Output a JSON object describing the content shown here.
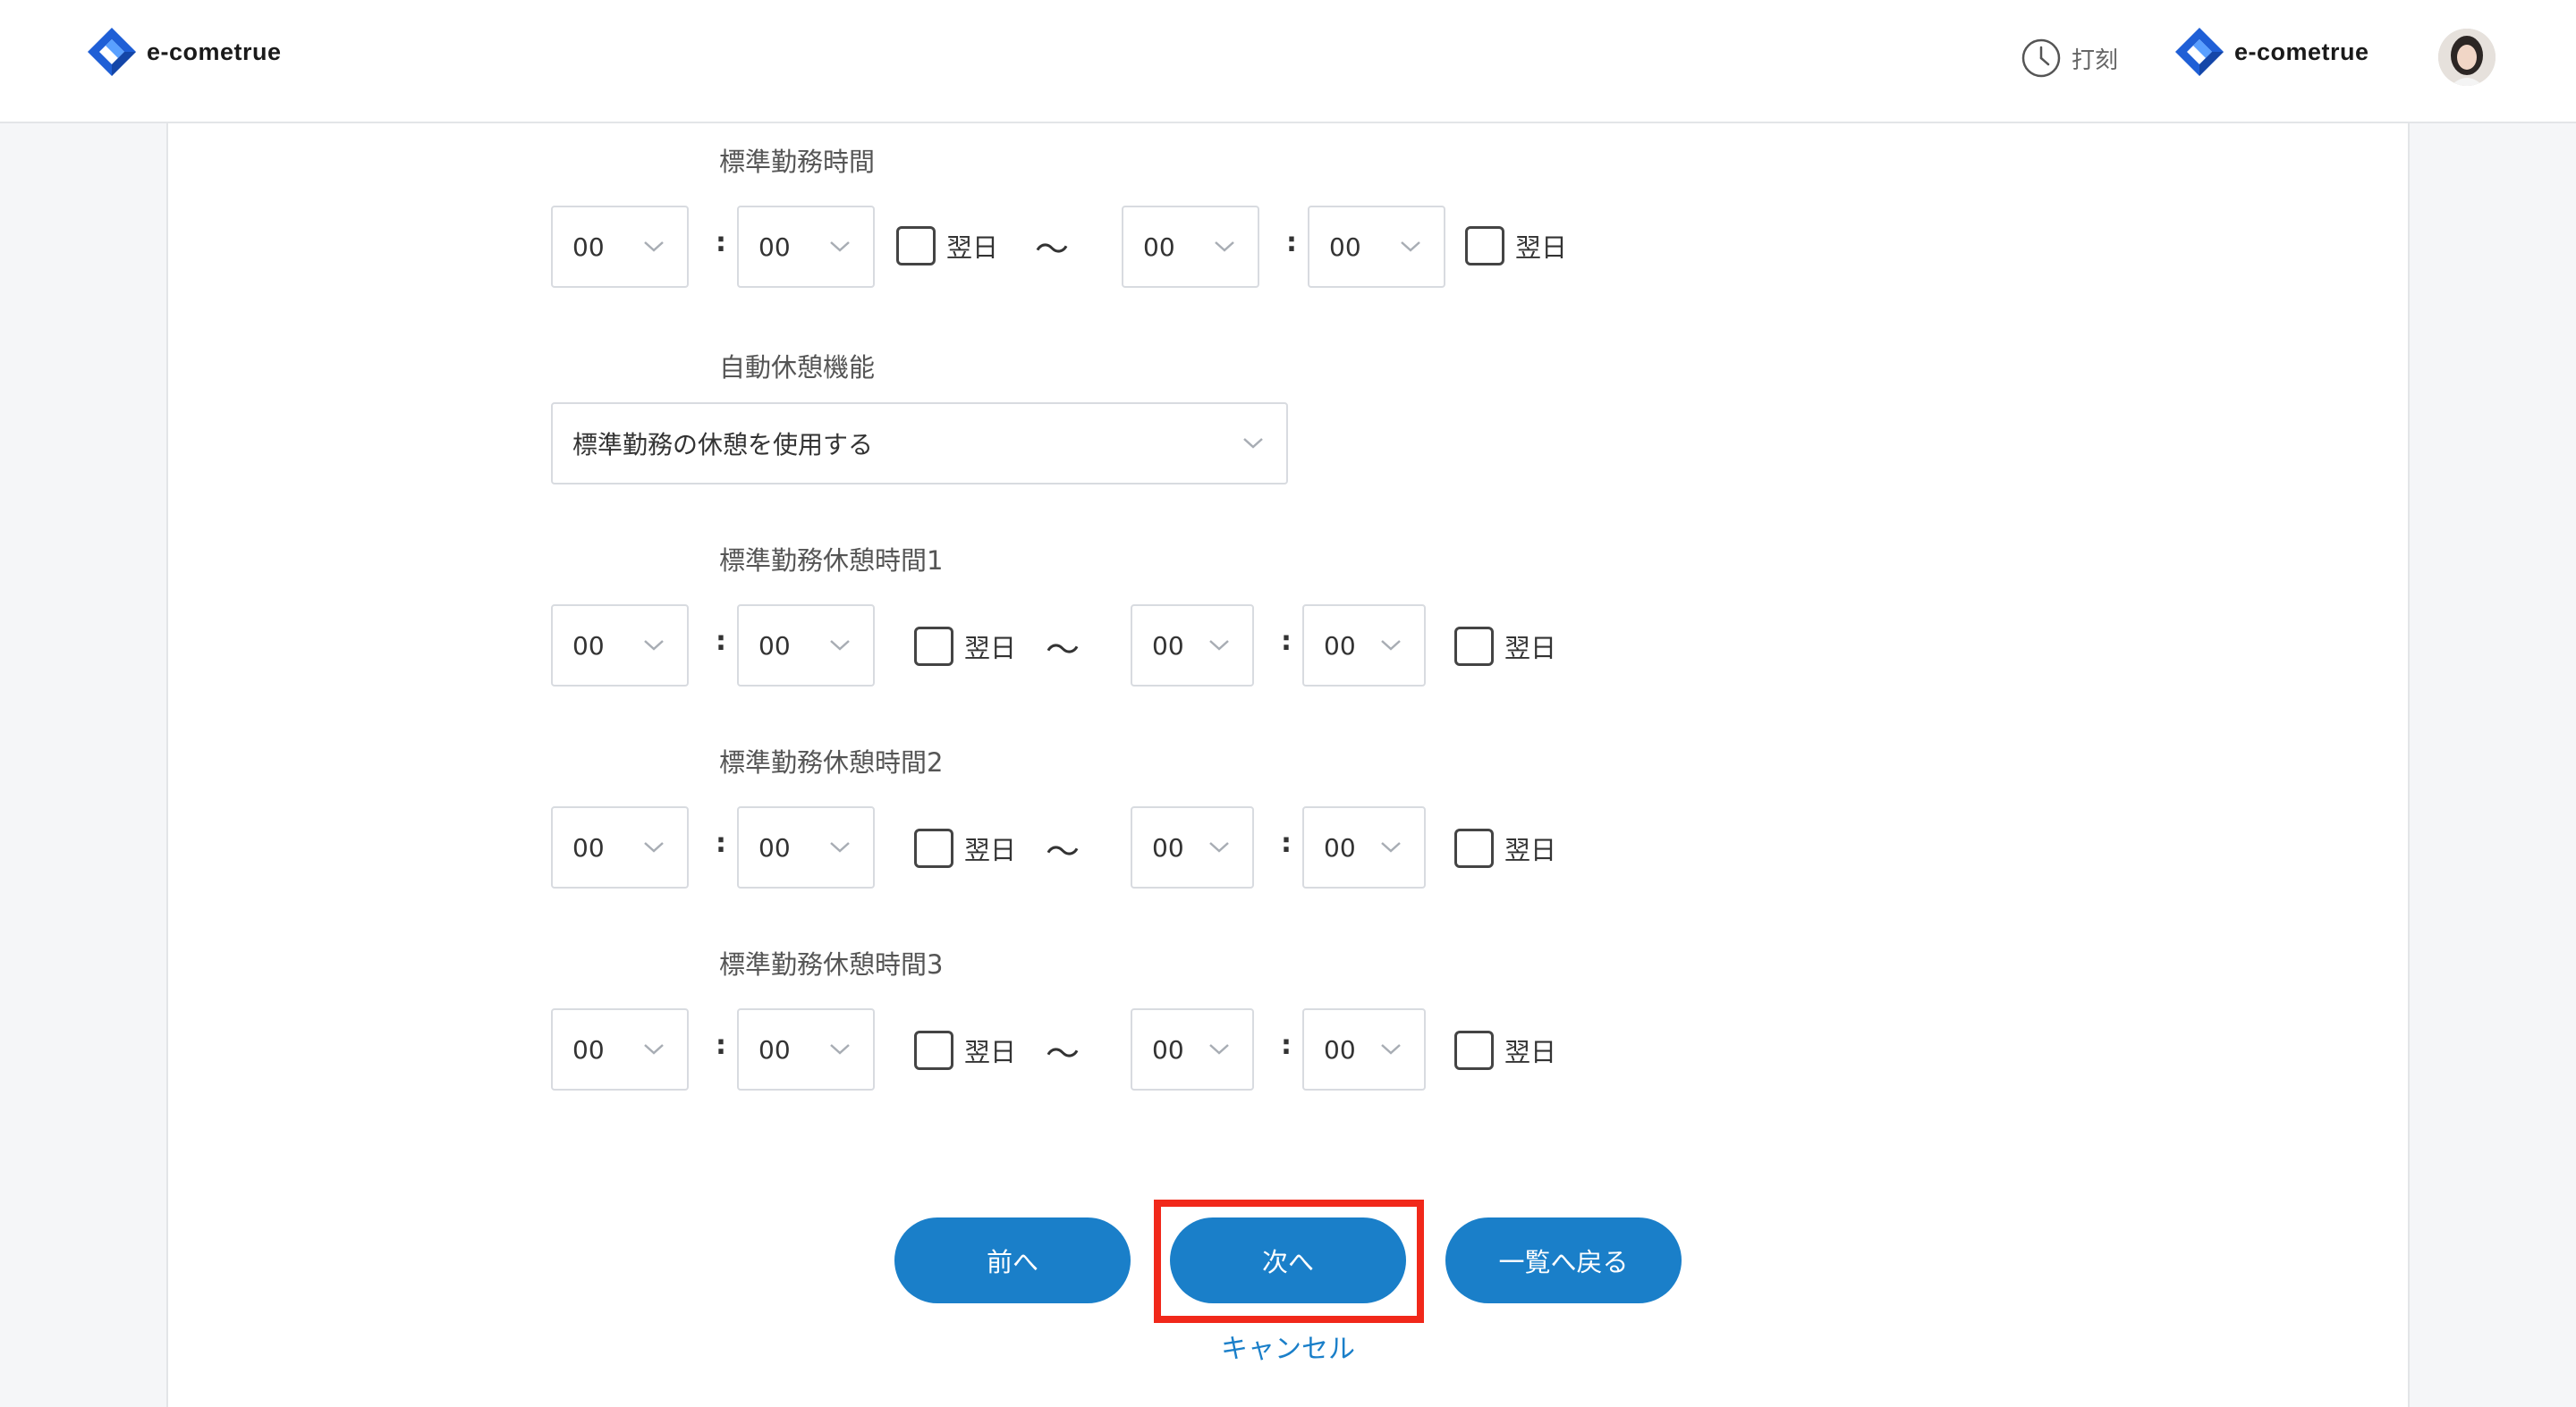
{
  "header": {
    "brand_text": "e-cometrue",
    "punch_label": "打刻",
    "brand_right_text": "e-cometrue"
  },
  "icons": {
    "logo": "diamond-logo-icon",
    "punch": "clock-icon",
    "dropdown": "chevron-down-icon",
    "avatar": "user-avatar"
  },
  "colors": {
    "primary": "#1a7fc9",
    "highlight": "#f1281a",
    "logo_blue": "#1f5fd6"
  },
  "form": {
    "standard_hours": {
      "label": "標準勤務時間",
      "start_hour": "00",
      "start_min": "00",
      "start_next_day": "翌日",
      "start_next_day_checked": false,
      "separator": "〜",
      "end_hour": "00",
      "end_min": "00",
      "end_next_day": "翌日",
      "end_next_day_checked": false
    },
    "auto_break": {
      "label": "自動休憩機能",
      "selected": "標準勤務の休憩を使用する"
    },
    "breaks": [
      {
        "label": "標準勤務休憩時間1",
        "start_hour": "00",
        "start_min": "00",
        "start_next_day": "翌日",
        "separator": "〜",
        "end_hour": "00",
        "end_min": "00",
        "end_next_day": "翌日"
      },
      {
        "label": "標準勤務休憩時間2",
        "start_hour": "00",
        "start_min": "00",
        "start_next_day": "翌日",
        "separator": "〜",
        "end_hour": "00",
        "end_min": "00",
        "end_next_day": "翌日"
      },
      {
        "label": "標準勤務休憩時間3",
        "start_hour": "00",
        "start_min": "00",
        "start_next_day": "翌日",
        "separator": "〜",
        "end_hour": "00",
        "end_min": "00",
        "end_next_day": "翌日"
      }
    ],
    "time_colon": ":"
  },
  "actions": {
    "prev": "前へ",
    "next": "次へ",
    "back_to_list": "一覧へ戻る",
    "cancel": "キャンセル"
  }
}
